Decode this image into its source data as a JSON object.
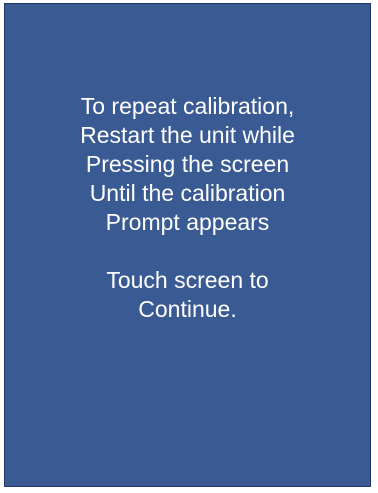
{
  "screen": {
    "background_color": "#3a5a94",
    "text_color": "#ffffff",
    "instructions": [
      "To repeat calibration,",
      "Restart the unit while",
      "Pressing the screen",
      "Until the calibration",
      "Prompt appears"
    ],
    "prompt": [
      "Touch screen to",
      "Continue."
    ]
  }
}
